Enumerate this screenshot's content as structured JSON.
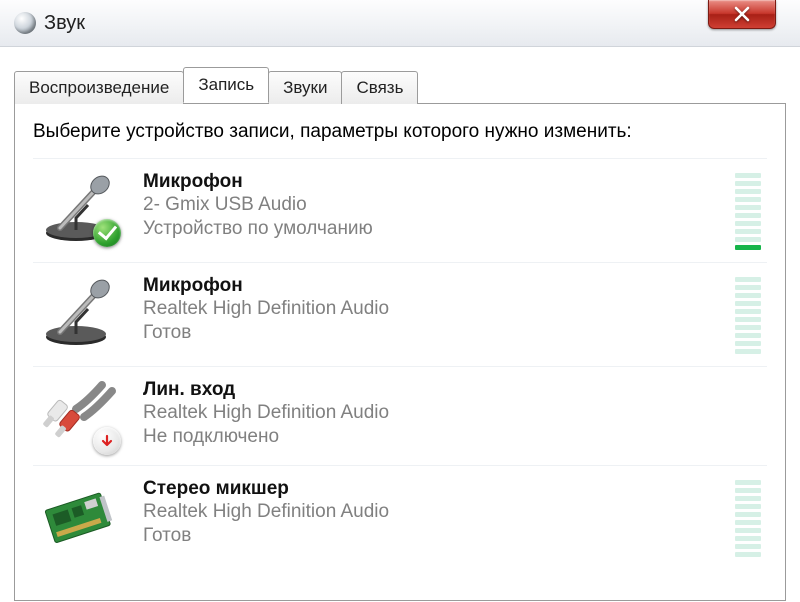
{
  "window": {
    "title": "Звук"
  },
  "tabs": [
    {
      "label": "Воспроизведение",
      "active": false
    },
    {
      "label": "Запись",
      "active": true
    },
    {
      "label": "Звуки",
      "active": false
    },
    {
      "label": "Связь",
      "active": false
    }
  ],
  "instruction": "Выберите устройство записи, параметры которого нужно изменить:",
  "devices": [
    {
      "icon": "microphone",
      "badge": "default",
      "name": "Микрофон",
      "subtitle": "2- Gmix USB Audio",
      "status": "Устройство по умолчанию",
      "level_segments": 10,
      "level_active": 1
    },
    {
      "icon": "microphone",
      "badge": null,
      "name": "Микрофон",
      "subtitle": "Realtek High Definition Audio",
      "status": "Готов",
      "level_segments": 10,
      "level_active": 0
    },
    {
      "icon": "line-in",
      "badge": "unplugged",
      "name": "Лин. вход",
      "subtitle": "Realtek High Definition Audio",
      "status": "Не подключено",
      "level_segments": 0,
      "level_active": 0
    },
    {
      "icon": "sound-card",
      "badge": null,
      "name": "Стерео микшер",
      "subtitle": "Realtek High Definition Audio",
      "status": "Готов",
      "level_segments": 10,
      "level_active": 0
    }
  ]
}
